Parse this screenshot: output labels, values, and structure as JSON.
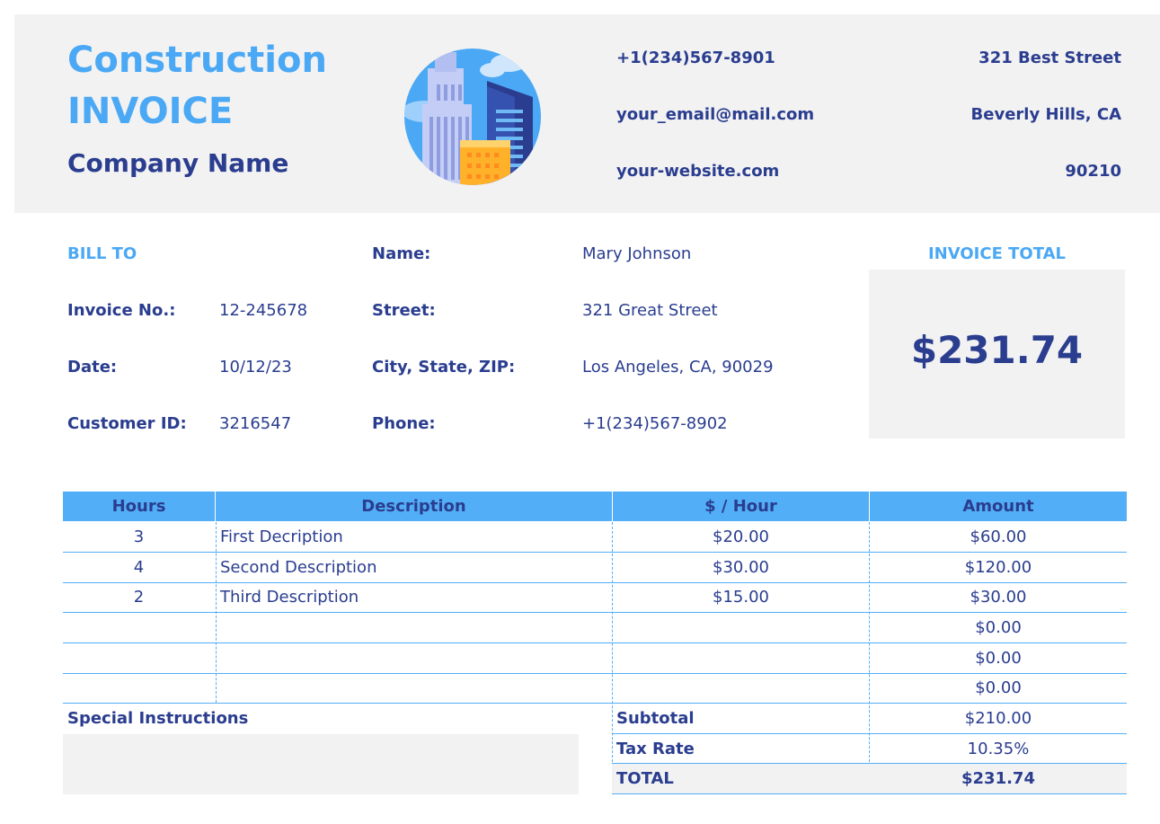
{
  "header": {
    "title_line1": "Construction",
    "title_line2": "INVOICE",
    "company": "Company Name",
    "phone": "+1(234)567-8901",
    "email": "your_email@mail.com",
    "website": "your-website.com",
    "street": "321 Best Street",
    "city": "Beverly Hills, CA",
    "zip": "90210"
  },
  "bill_to": {
    "heading": "BILL TO",
    "invoice_no_label": "Invoice No.:",
    "invoice_no": "12-245678",
    "date_label": "Date:",
    "date": "10/12/23",
    "customer_id_label": "Customer ID:",
    "customer_id": "3216547",
    "name_label": "Name:",
    "name": "Mary Johnson",
    "street_label": "Street:",
    "street": "321 Great Street",
    "city_label": "City, State, ZIP:",
    "city": "Los Angeles, CA, 90029",
    "phone_label": "Phone:",
    "phone": "+1(234)567-8902"
  },
  "invoice_total": {
    "heading": "INVOICE TOTAL",
    "amount": "$231.74"
  },
  "table": {
    "columns": [
      "Hours",
      "Description",
      "$ / Hour",
      "Amount"
    ],
    "rows": [
      {
        "hours": "3",
        "description": "First Decription",
        "rate": "$20.00",
        "amount": "$60.00"
      },
      {
        "hours": "4",
        "description": "Second Description",
        "rate": "$30.00",
        "amount": "$120.00"
      },
      {
        "hours": "2",
        "description": "Third Description",
        "rate": "$15.00",
        "amount": "$30.00"
      },
      {
        "hours": "",
        "description": "",
        "rate": "",
        "amount": "$0.00"
      },
      {
        "hours": "",
        "description": "",
        "rate": "",
        "amount": "$0.00"
      },
      {
        "hours": "",
        "description": "",
        "rate": "",
        "amount": "$0.00"
      }
    ]
  },
  "summary": {
    "special_label": "Special Instructions",
    "subtotal_label": "Subtotal",
    "subtotal": "$210.00",
    "tax_label": "Tax Rate",
    "tax": "10.35%",
    "total_label": "TOTAL",
    "total": "$231.74"
  },
  "colors": {
    "accent": "#4aa8f5",
    "header_fill": "#52aef7",
    "text": "#2a3d8f",
    "panel": "#f2f2f2"
  },
  "icons": {
    "logo": "buildings-illustration"
  }
}
